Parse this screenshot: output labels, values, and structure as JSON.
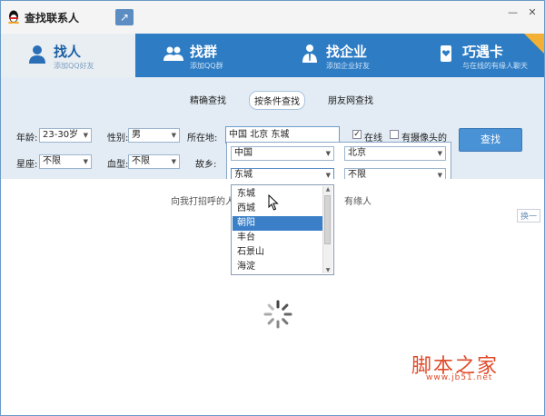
{
  "window": {
    "title": "查找联系人",
    "controls": [
      "—",
      "✕"
    ]
  },
  "tabs": [
    {
      "label": "找人",
      "sub": "添加QQ好友",
      "icon": "person-icon",
      "active": true
    },
    {
      "label": "找群",
      "sub": "添加QQ群",
      "icon": "group-icon",
      "active": false
    },
    {
      "label": "找企业",
      "sub": "添加企业好友",
      "icon": "enterprise-icon",
      "active": false
    },
    {
      "label": "巧遇卡",
      "sub": "与在线的有缘人聊天",
      "icon": "card-icon",
      "active": false
    }
  ],
  "subtabs": [
    {
      "label": "精确查找",
      "active": false
    },
    {
      "label": "按条件查找",
      "active": true
    },
    {
      "label": "朋友网查找",
      "active": false
    }
  ],
  "form": {
    "age_label": "年龄:",
    "age_value": "23-30岁",
    "gender_label": "性别:",
    "gender_value": "男",
    "location_label": "所在地:",
    "location_value": "中国  北京  东城",
    "online_label": "在线",
    "online_checked": true,
    "camera_label": "有摄像头的",
    "camera_checked": false,
    "constellation_label": "星座:",
    "constellation_value": "不限",
    "blood_label": "血型:",
    "blood_value": "不限",
    "hometown_label": "故乡:",
    "search_button": "查找"
  },
  "location_popup": {
    "country": "中国",
    "province": "北京",
    "district": "东城",
    "extra": "不限"
  },
  "district_list": {
    "items": [
      "东城",
      "西城",
      "朝阳",
      "丰台",
      "石景山",
      "海淀"
    ],
    "selected_index": 2
  },
  "results": {
    "message_left": "向我打招呼的人",
    "message_right": "有缘人",
    "change_label": "换一"
  },
  "watermark": {
    "cn": "脚本之家",
    "url": "www.jb51.net"
  }
}
